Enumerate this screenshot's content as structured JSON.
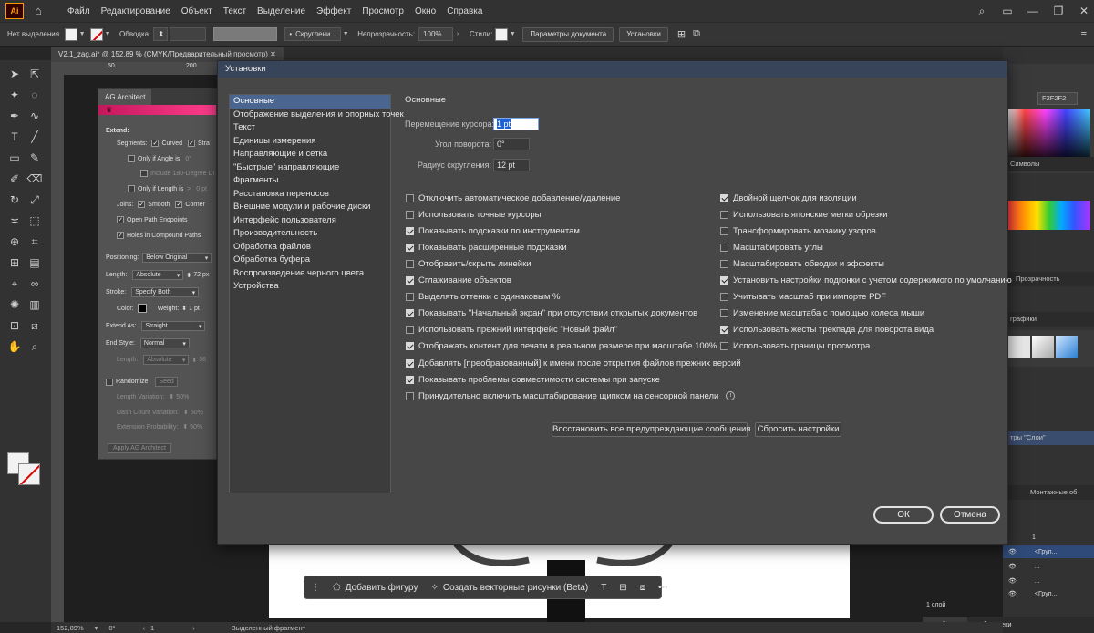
{
  "app": {
    "logo": "Ai",
    "menu": [
      "Файл",
      "Редактирование",
      "Объект",
      "Текст",
      "Выделение",
      "Эффект",
      "Просмотр",
      "Окно",
      "Справка"
    ]
  },
  "controlbar": {
    "selection_status": "Нет выделения",
    "stroke_label": "Обводка:",
    "brush_label": "Скруглени...",
    "opacity_label": "Непрозрачность:",
    "opacity_value": "100%",
    "styles_label": "Стили:",
    "doc_settings_button": "Параметры документа",
    "preferences_button": "Установки"
  },
  "document": {
    "tab_title": "V2.1_zag.ai* @ 152,89 % (CMYK/Предварительный просмотр)",
    "ruler_marks": [
      "50",
      "200"
    ]
  },
  "ag_panel": {
    "tab": "AG Architect",
    "extend_label": "Extend:",
    "segments_label": "Segments:",
    "curved": "Curved",
    "straight_short": "Stra",
    "only_if_angle": "Only if Angle is",
    "angle_value": "0°",
    "include_180": "Include 180-Degree Di",
    "only_if_length": "Only if Length is",
    "length_op": ">",
    "length_value": "0 pt",
    "joins_label": "Joins:",
    "smooth": "Smooth",
    "corner": "Corner",
    "open_endpoints": "Open Path Endpoints",
    "holes": "Holes in Compound Paths",
    "positioning_label": "Positioning:",
    "positioning_value": "Below Original",
    "length_label": "Length:",
    "length_mode": "Absolute",
    "length_pt": "72 px",
    "stroke_label": "Stroke:",
    "stroke_value": "Specify Both",
    "color_label": "Color:",
    "weight_label": "Weight:",
    "weight_value": "1 pt",
    "extend_as_label": "Extend As:",
    "extend_as_value": "Straight",
    "end_style_label": "End Style:",
    "end_style_value": "Normal",
    "length2_label": "Length:",
    "length2_value": "Absolute",
    "length2_num": "36",
    "randomize": "Randomize",
    "seed": "Seed",
    "length_variation": "Length Variation:",
    "length_variation_value": "50%",
    "dash_count_variation": "Dash Count Variation:",
    "dash_count_value": "50%",
    "extension_probability": "Extension Probability:",
    "extension_probability_value": "50%",
    "apply_button": "Apply AG Architect"
  },
  "dialog": {
    "title": "Установки",
    "categories": [
      "Основные",
      "Отображение выделения и опорных точек",
      "Текст",
      "Единицы измерения",
      "Направляющие и сетка",
      "\"Быстрые\" направляющие",
      "Фрагменты",
      "Расстановка переносов",
      "Внешние модули и рабочие диски",
      "Интерфейс пользователя",
      "Производительность",
      "Обработка файлов",
      "Обработка буфера",
      "Воспроизведение черного цвета",
      "Устройства"
    ],
    "section_title": "Основные",
    "fields": {
      "cursor_label": "Перемещение курсора:",
      "cursor_value": "1 pt",
      "angle_label": "Угол поворота:",
      "angle_value": "0°",
      "radius_label": "Радиус скругления:",
      "radius_value": "12 pt"
    },
    "left_options": [
      {
        "label": "Отключить автоматическое добавление/удаление",
        "checked": false
      },
      {
        "label": "Использовать точные курсоры",
        "checked": false
      },
      {
        "label": "Показывать подсказки по инструментам",
        "checked": true
      },
      {
        "label": "Показывать расширенные подсказки",
        "checked": true
      },
      {
        "label": "Отобразить/скрыть линейки",
        "checked": false
      },
      {
        "label": "Сглаживание объектов",
        "checked": true
      },
      {
        "label": "Выделять оттенки с одинаковым %",
        "checked": false
      },
      {
        "label": "Показывать \"Начальный экран\" при отсутствии открытых документов",
        "checked": true
      },
      {
        "label": "Использовать прежний интерфейс \"Новый файл\"",
        "checked": false
      },
      {
        "label": "Отображать контент для печати в реальном размере при масштабе 100%",
        "checked": true
      },
      {
        "label": "Добавлять [преобразованный] к имени после открытия файлов прежних версий",
        "checked": true
      },
      {
        "label": "Показывать проблемы совместимости системы при запуске",
        "checked": true
      },
      {
        "label": "Принудительно включить масштабирование щипком на сенсорной панели",
        "checked": false
      }
    ],
    "right_options": [
      {
        "label": "Двойной щелчок для изоляции",
        "checked": true
      },
      {
        "label": "Использовать японские метки обрезки",
        "checked": false
      },
      {
        "label": "Трансформировать мозаику узоров",
        "checked": false
      },
      {
        "label": "Масштабировать углы",
        "checked": false
      },
      {
        "label": "Масштабировать обводки и эффекты",
        "checked": false
      },
      {
        "label": "Установить настройки подгонки с учетом содержимого по умолчанию",
        "checked": true
      },
      {
        "label": "Учитывать масштаб при импорте PDF",
        "checked": false
      },
      {
        "label": "Изменение масштаба с помощью колеса мыши",
        "checked": false
      },
      {
        "label": "Использовать жесты трекпада для поворота вида",
        "checked": true
      },
      {
        "label": "Использовать границы просмотра",
        "checked": false
      }
    ],
    "reset_warnings_button": "Восстановить все предупреждающие сообщения",
    "reset_settings_button": "Сбросить настройки",
    "ok_button": "ОК",
    "cancel_button": "Отмена"
  },
  "right_panels": {
    "hex_value": "F2F2F2",
    "symbols_label": "Символы",
    "transparency_label": "Прозрачность",
    "graphics_label": "графики",
    "layer_style_label": "тры \"Слои\"",
    "artboards_label": "Монтажные об",
    "layer_row_1": "1",
    "layer_row_2": "<Груп...",
    "layer_row_3": "...",
    "layer_row_4": "...",
    "layer_row_5": "<Груп...",
    "layers_count": "1 слой",
    "properties_tab": "Свойства",
    "libraries_tab": "Библиотеки"
  },
  "taskbar": {
    "add_shape": "Добавить фигуру",
    "vectorize": "Создать векторные рисунки (Beta)"
  },
  "statusbar": {
    "zoom": "152,89%",
    "rotation": "0°",
    "artboard": "1",
    "selection": "Выделенный фрагмент"
  }
}
